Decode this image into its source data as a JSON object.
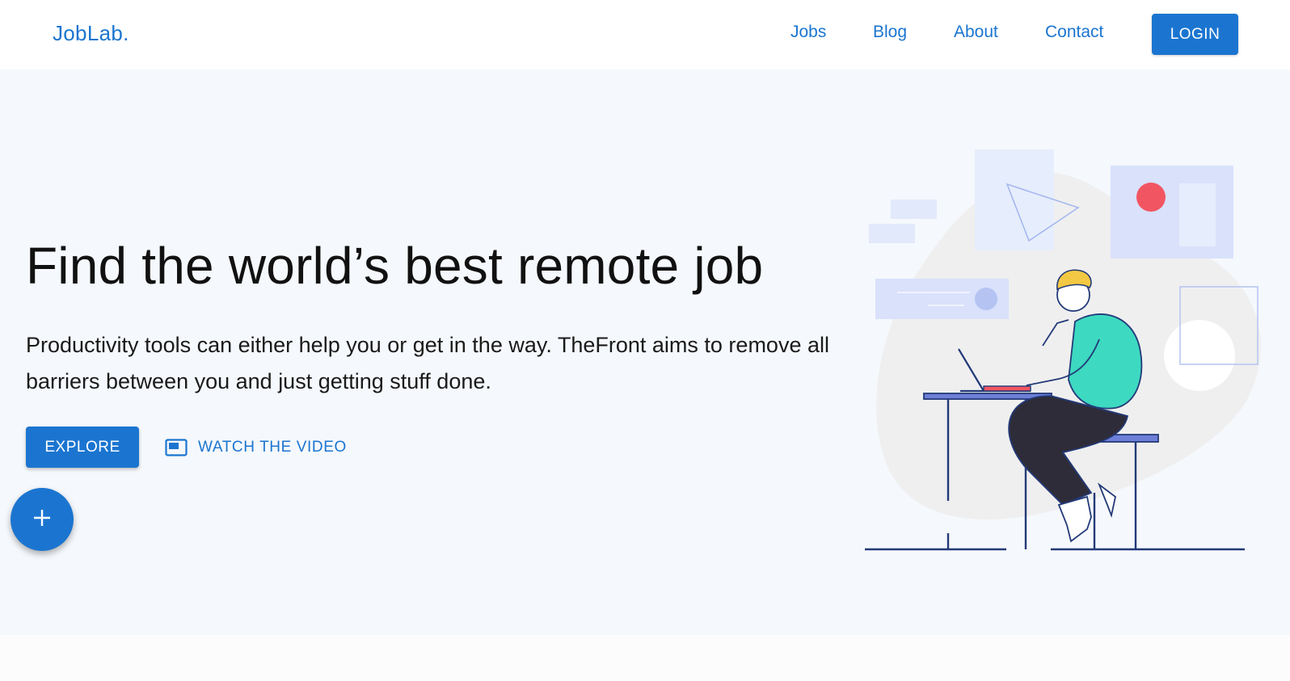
{
  "header": {
    "logo": "JobLab.",
    "nav": [
      "Jobs",
      "Blog",
      "About",
      "Contact"
    ],
    "login_label": "LOGIN"
  },
  "hero": {
    "title": "Find the world’s best remote job",
    "subtitle": "Productivity tools can either help you or get in the way. TheFront aims to remove all barriers between you and just getting stuff done.",
    "explore_label": "EXPLORE",
    "video_label": "WATCH THE VIDEO",
    "fab_icon": "plus-icon"
  },
  "colors": {
    "primary": "#1b75d0",
    "hero_bg": "#f5f8fc",
    "accent_red": "#f25562",
    "shirt": "#3dd9c1"
  }
}
